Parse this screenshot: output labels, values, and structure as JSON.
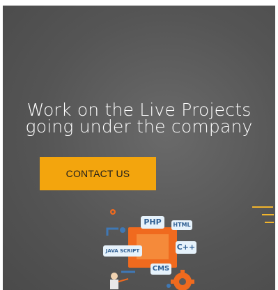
{
  "hero": {
    "headline_line1": "Work on the Live Projects",
    "headline_line2": "going under the company",
    "cta_label": "CONTACT US"
  },
  "menu": {
    "icon": "hamburger-menu-icon"
  },
  "illustration": {
    "tags": [
      "PHP",
      "HTML",
      "C++",
      "JAVA SCRIPT",
      "CMS"
    ]
  },
  "colors": {
    "accent": "#f3a50d",
    "hero_background": "#555555",
    "headline_text": "#ffffff",
    "illustration_orange": "#f06a1e",
    "tag_background": "#e6f2fb",
    "tag_text": "#2f5f93"
  }
}
